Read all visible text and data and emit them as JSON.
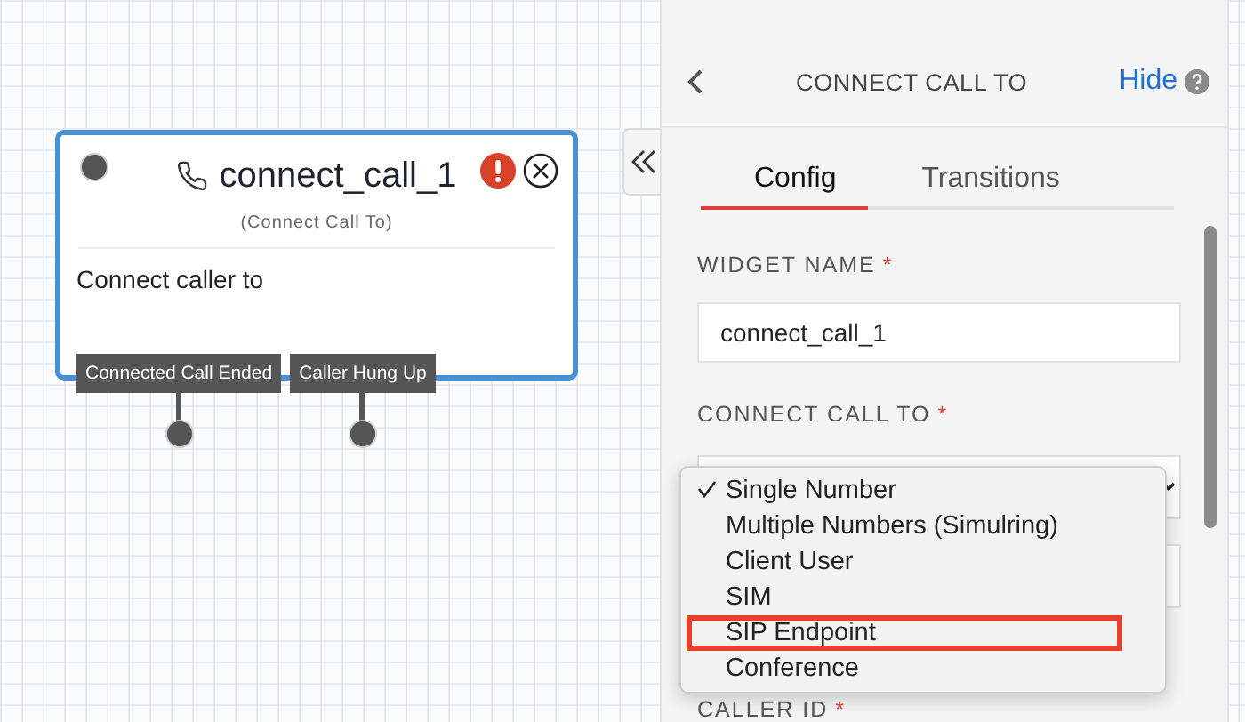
{
  "node": {
    "title": "connect_call_1",
    "subtitle": "(Connect Call To)",
    "body": "Connect caller to",
    "has_error": true,
    "transitions": [
      {
        "label": "Connected Call Ended"
      },
      {
        "label": "Caller Hung Up"
      }
    ]
  },
  "panel": {
    "title": "CONNECT CALL TO",
    "hide_link": "Hide",
    "tabs": [
      {
        "label": "Config",
        "selected": true
      },
      {
        "label": "Transitions",
        "selected": false
      }
    ],
    "fields": [
      {
        "label": "WIDGET NAME",
        "required_mark": "*",
        "value": "connect_call_1"
      },
      {
        "label": "CONNECT CALL TO",
        "required_mark": "*"
      }
    ],
    "next_field_label": "CALLER ID",
    "next_field_required_mark": "*"
  },
  "dropdown": {
    "options": [
      {
        "label": "Single Number",
        "selected": true,
        "annotated": false
      },
      {
        "label": "Multiple Numbers (Simulring)",
        "selected": false,
        "annotated": false
      },
      {
        "label": "Client User",
        "selected": false,
        "annotated": false
      },
      {
        "label": "SIM",
        "selected": false,
        "annotated": false
      },
      {
        "label": "SIP Endpoint",
        "selected": false,
        "annotated": true
      },
      {
        "label": "Conference",
        "selected": false,
        "annotated": false
      }
    ]
  }
}
